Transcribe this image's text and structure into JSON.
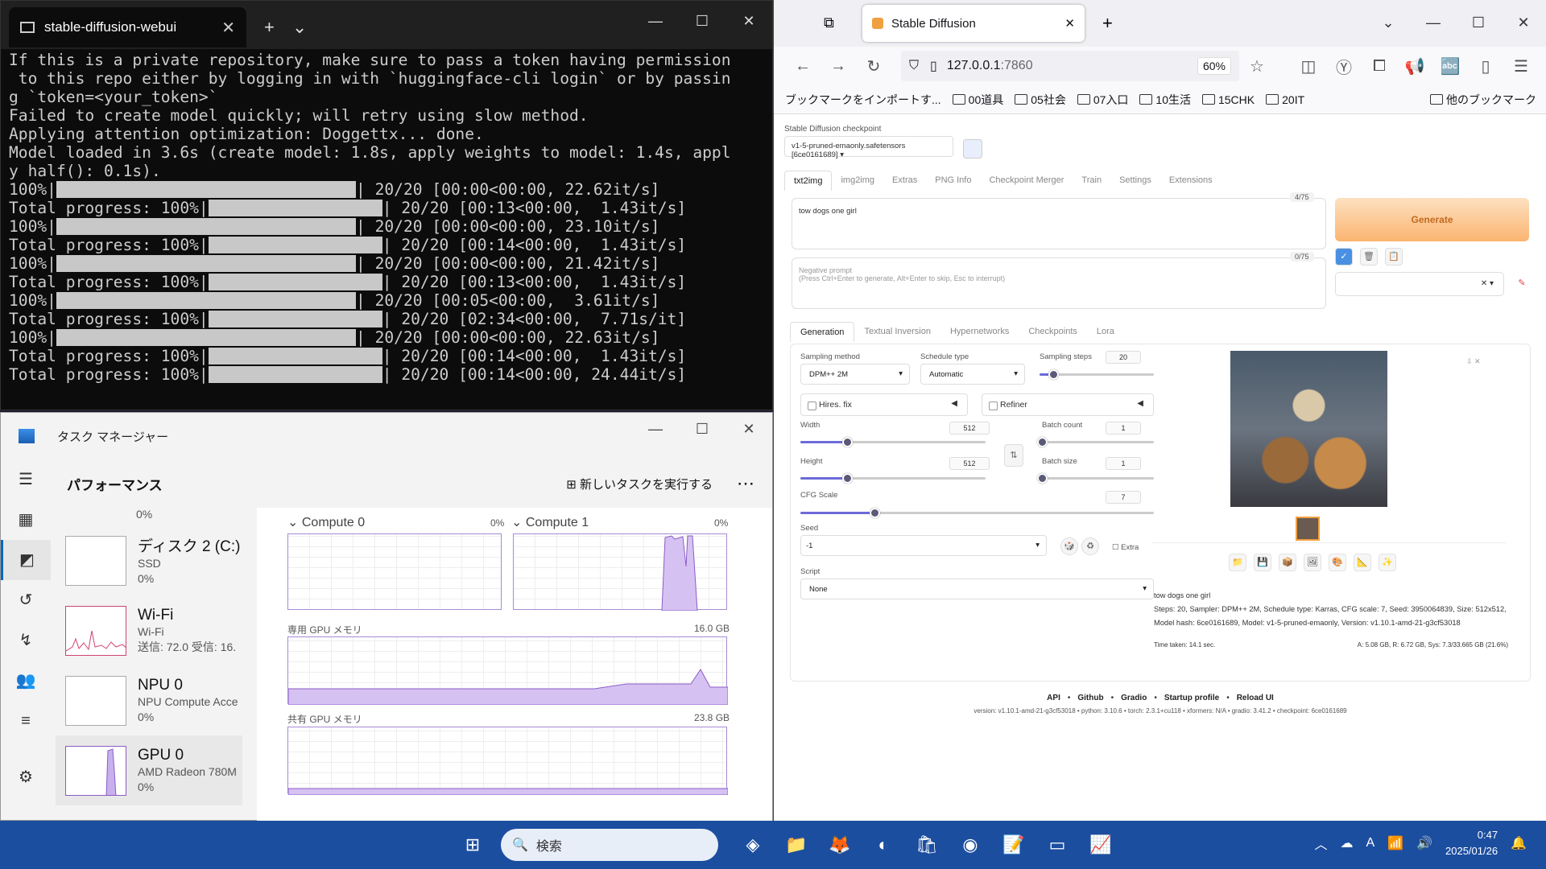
{
  "terminal": {
    "tab_title": "stable-diffusion-webui",
    "lines": [
      "If this is a private repository, make sure to pass a token having permission",
      " to this repo either by logging in with `huggingface-cli login` or by passin",
      "g `token=<your_token>`",
      "",
      "Failed to create model quickly; will retry using slow method.",
      "Applying attention optimization: Doggettx... done.",
      "Model loaded in 3.6s (create model: 1.8s, apply weights to model: 1.4s, appl",
      "y half(): 0.1s)."
    ],
    "progress": [
      {
        "label": "100%|",
        "short": false,
        "stat": "| 20/20 [00:00<00:00, 22.62it/s]"
      },
      {
        "label": "Total progress: 100%|",
        "short": true,
        "stat": "| 20/20 [00:13<00:00,  1.43it/s]"
      },
      {
        "label": "100%|",
        "short": false,
        "stat": "| 20/20 [00:00<00:00, 23.10it/s]"
      },
      {
        "label": "Total progress: 100%|",
        "short": true,
        "stat": "| 20/20 [00:14<00:00,  1.43it/s]"
      },
      {
        "label": "100%|",
        "short": false,
        "stat": "| 20/20 [00:00<00:00, 21.42it/s]"
      },
      {
        "label": "Total progress: 100%|",
        "short": true,
        "stat": "| 20/20 [00:13<00:00,  1.43it/s]"
      },
      {
        "label": "100%|",
        "short": false,
        "stat": "| 20/20 [00:05<00:00,  3.61it/s]"
      },
      {
        "label": "Total progress: 100%|",
        "short": true,
        "stat": "| 20/20 [02:34<00:00,  7.71s/it]"
      },
      {
        "label": "100%|",
        "short": false,
        "stat": "| 20/20 [00:00<00:00, 22.63it/s]"
      },
      {
        "label": "Total progress: 100%|",
        "short": true,
        "stat": "| 20/20 [00:14<00:00,  1.43it/s]"
      },
      {
        "label": "Total progress: 100%|",
        "short": true,
        "stat": "| 20/20 [00:14<00:00, 24.44it/s]"
      }
    ]
  },
  "taskmgr": {
    "title": "タスク マネージャー",
    "section": "パフォーマンス",
    "new_task": "新しいタスクを実行する",
    "items": [
      {
        "name": "ディスク 2 (C:)",
        "sub1": "SSD",
        "sub2": "0%"
      },
      {
        "name": "Wi-Fi",
        "sub1": "Wi-Fi",
        "sub2": "送信: 72.0 受信: 16."
      },
      {
        "name": "NPU 0",
        "sub1": "NPU Compute Acce",
        "sub2": "0%"
      },
      {
        "name": "GPU 0",
        "sub1": "AMD Radeon 780M",
        "sub2": "0%"
      }
    ],
    "top_partial": "0%",
    "graphs": {
      "c0": "Compute 0",
      "c0v": "0%",
      "c1": "Compute 1",
      "c1v": "0%",
      "ded": "専用 GPU メモリ",
      "dedv": "16.0 GB",
      "sha": "共有 GPU メモリ",
      "shav": "23.8 GB"
    }
  },
  "browser": {
    "tab_title": "Stable Diffusion",
    "url_host": "127.0.0.1",
    "url_port": ":7860",
    "zoom": "60%",
    "bookmarks": [
      "ブックマークをインポートす...",
      "00道具",
      "05社会",
      "07入口",
      "10生活",
      "15CHK",
      "20IT",
      "他のブックマーク"
    ]
  },
  "sd": {
    "ckpt_label": "Stable Diffusion checkpoint",
    "ckpt": "v1-5-pruned-emaonly.safetensors [6ce0161689]",
    "tabs": [
      "txt2img",
      "img2img",
      "Extras",
      "PNG Info",
      "Checkpoint Merger",
      "Train",
      "Settings",
      "Extensions"
    ],
    "prompt": "tow dogs one girl",
    "prompt_count": "4/75",
    "neg_placeholder": "Negative prompt\n(Press Ctrl+Enter to generate, Alt+Enter to skip, Esc to interrupt)",
    "neg_count": "0/75",
    "generate": "Generate",
    "gen_tabs": [
      "Generation",
      "Textual Inversion",
      "Hypernetworks",
      "Checkpoints",
      "Lora"
    ],
    "sampling_method_label": "Sampling method",
    "sampling_method": "DPM++ 2M",
    "schedule_label": "Schedule type",
    "schedule": "Automatic",
    "steps_label": "Sampling steps",
    "steps": "20",
    "hires": "Hires. fix",
    "refiner": "Refiner",
    "width_label": "Width",
    "width": "512",
    "height_label": "Height",
    "height": "512",
    "batch_count_label": "Batch count",
    "batch_count": "1",
    "batch_size_label": "Batch size",
    "batch_size": "1",
    "cfg_label": "CFG Scale",
    "cfg": "7",
    "seed_label": "Seed",
    "seed": "-1",
    "extra": "Extra",
    "script_label": "Script",
    "script": "None",
    "info_prompt": "tow dogs one girl",
    "info_params": "Steps: 20, Sampler: DPM++ 2M, Schedule type: Karras, CFG scale: 7, Seed: 3950064839, Size: 512x512, Model hash: 6ce0161689, Model: v1-5-pruned-emaonly, Version: v1.10.1-amd-21-g3cf53018",
    "time_taken": "Time taken: 14.1 sec.",
    "mem": "A: 5.08 GB, R: 6.72 GB, Sys: 7.3/33.665 GB (21.6%)",
    "footer_links": [
      "API",
      "Github",
      "Gradio",
      "Startup profile",
      "Reload UI"
    ],
    "footer_version": "version: v1.10.1-amd-21-g3cf53018  •  python: 3.10.6  •  torch: 2.3.1+cu118  •  xformers: N/A  •  gradio: 3.41.2  •  checkpoint: 6ce0161689",
    "sliders": {
      "steps": 0.12,
      "width": 0.25,
      "height": 0.25,
      "cfg": 0.21,
      "batch_count": 0,
      "batch_size": 0
    }
  },
  "taskbar": {
    "search": "検索",
    "time": "0:47",
    "date": "2025/01/26"
  }
}
